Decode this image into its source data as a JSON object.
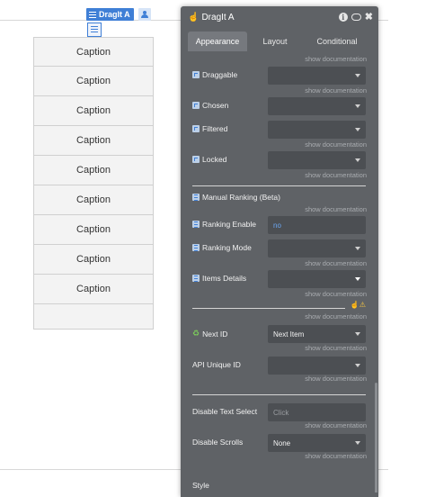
{
  "element": {
    "name": "DragIt A",
    "cells": [
      "Caption",
      "Caption",
      "Caption",
      "Caption",
      "Caption",
      "Caption",
      "Caption",
      "Caption",
      "Caption"
    ]
  },
  "panel": {
    "title": "DragIt A",
    "tabs": [
      "Appearance",
      "Layout",
      "Conditional"
    ],
    "active_tab": "Appearance",
    "doc_link": "show documentation",
    "fields": {
      "draggable": {
        "label": "Draggable",
        "value": ""
      },
      "chosen": {
        "label": "Chosen",
        "value": ""
      },
      "filtered": {
        "label": "Filtered",
        "value": ""
      },
      "locked": {
        "label": "Locked",
        "value": ""
      },
      "manual_ranking": {
        "label": "Manual Ranking (Beta)"
      },
      "ranking_enable": {
        "label": "Ranking Enable",
        "value": "no"
      },
      "ranking_mode": {
        "label": "Ranking Mode",
        "value": ""
      },
      "items_details": {
        "label": "Items Details",
        "value": ""
      },
      "next_id": {
        "label": "Next ID",
        "value": "Next Item"
      },
      "api_unique_id": {
        "label": "API Unique ID",
        "value": ""
      },
      "disable_text_select": {
        "label": "Disable Text Select",
        "placeholder": "Click"
      },
      "disable_scrolls": {
        "label": "Disable Scrolls",
        "value": "None"
      }
    },
    "style_label": "Style"
  },
  "colors": {
    "panel_bg": "#5f6266",
    "accent": "#3f7fd6",
    "input_bg": "#4c4f53"
  }
}
